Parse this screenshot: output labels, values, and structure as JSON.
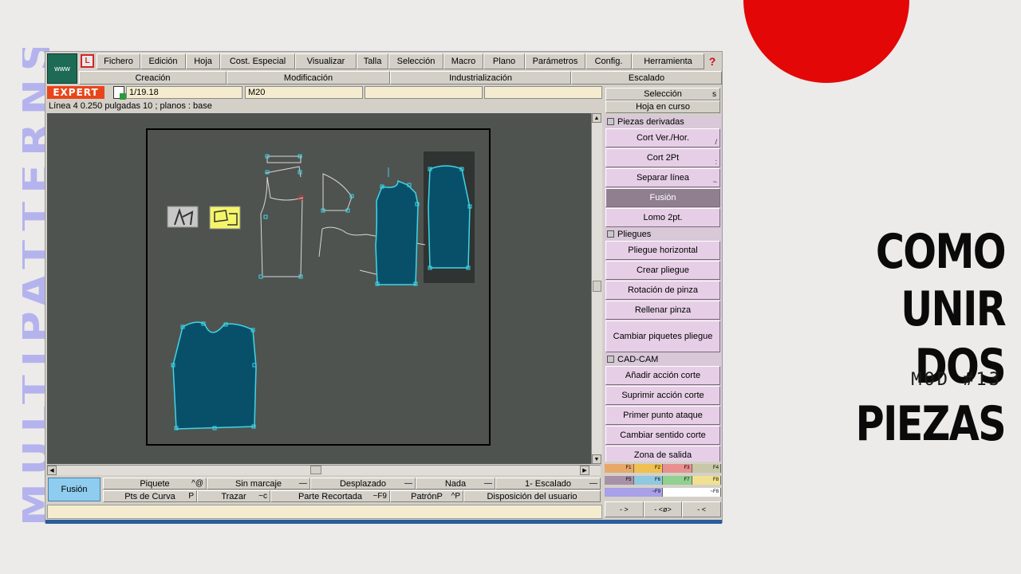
{
  "overlay": {
    "side_text": "MULTIPATTERNS",
    "title_line1": "COMO UNIR",
    "title_line2": "DOS PIEZAS",
    "subtitle": "MOD #13"
  },
  "app": {
    "logo": "www",
    "menu": [
      "Fichero",
      "Edición",
      "Hoja",
      "Cost. Especial",
      "Visualizar",
      "Talla",
      "Selección",
      "Macro",
      "Plano",
      "Parámetros",
      "Config.",
      "Herramienta"
    ],
    "help": "?",
    "modes": [
      "Creación",
      "Modificación",
      "Industrialización",
      "Escalado"
    ],
    "expert_label": "EXPERT",
    "fields": {
      "scale": "1/19.18",
      "size": "M20"
    },
    "status_line": "Línea 4 0.250 pulgadas 10 ;    planos :  base",
    "right_head": {
      "selection": "Selección",
      "selection_key": "s",
      "sheet": "Hoja en curso"
    },
    "sections": {
      "derived": "Piezas derivadas",
      "pleats": "Pliegues",
      "cadcam": "CAD-CAM"
    },
    "derived_buttons": [
      {
        "label": "Cort Ver./Hor.",
        "key": "/"
      },
      {
        "label": "Cort 2Pt",
        "key": ":"
      },
      {
        "label": "Separar línea",
        "key": "~"
      },
      {
        "label": "Fusión",
        "key": ""
      },
      {
        "label": "Lomo 2pt.",
        "key": ""
      }
    ],
    "pleat_buttons": [
      "Pliegue horizontal",
      "Crear pliegue",
      "Rotación de pinza",
      "Rellenar pinza",
      "Cambiar piquetes pliegue"
    ],
    "cadcam_buttons": [
      "Añadir acción corte",
      "Suprimir acción corte",
      "Primer punto ataque",
      "Cambiar sentido corte",
      "Zona de salida"
    ],
    "fkeys_row1": [
      "F1",
      "F2",
      "F3",
      "F4"
    ],
    "fkeys_row2": [
      "F5",
      "F6",
      "F7",
      "F8"
    ],
    "fkeys_row3": [
      "~F9",
      "~F8"
    ],
    "bottom_nav": [
      "- >",
      "- <ø>",
      "- <"
    ],
    "current_tool": "Fusión",
    "options_row1": [
      {
        "label": "Piquete",
        "key": "^@"
      },
      {
        "label": "Sin marcaje",
        "key": "—"
      },
      {
        "label": "Desplazado",
        "key": "—"
      },
      {
        "label": "Nada",
        "key": "—"
      },
      {
        "label": "1- Escalado",
        "key": "—"
      }
    ],
    "options_row2": [
      {
        "label": "Pts de Curva",
        "key": "P"
      },
      {
        "label": "Trazar",
        "key": "~c"
      },
      {
        "label": "Parte Recortada",
        "key": "~F9"
      },
      {
        "label": "PatrónP",
        "key": "^P"
      },
      {
        "label": "Disposición del usuario",
        "key": ""
      }
    ],
    "colors": {
      "piece_fill": "#08506a",
      "outline": "#3fd6e6",
      "canvas": "#4e5350",
      "accent": "#e30707"
    }
  }
}
